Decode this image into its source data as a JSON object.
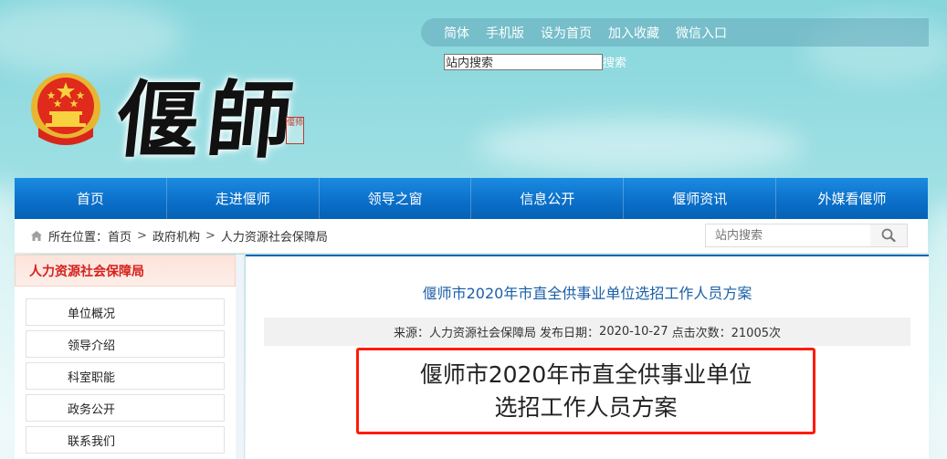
{
  "header": {
    "logo_text": "偃師",
    "seal_text": "偃师",
    "emblem_icon": "national-emblem",
    "top_links": [
      "简体",
      "手机版",
      "设为首页",
      "加入收藏",
      "微信入口"
    ],
    "top_search": {
      "value": "站内搜索",
      "button_label": "搜索"
    }
  },
  "nav": {
    "items": [
      "首页",
      "走进偃师",
      "领导之窗",
      "信息公开",
      "偃师资讯",
      "外媒看偃师"
    ]
  },
  "breadcrumb": {
    "home_icon": "home-icon",
    "label": "所在位置：",
    "items": [
      "首页",
      "政府机构",
      "人力资源社会保障局"
    ],
    "separator": ">"
  },
  "crumb_search": {
    "placeholder": "站内搜索",
    "icon": "search-icon"
  },
  "sidebar": {
    "title": "人力资源社会保障局",
    "items": [
      "单位概况",
      "领导介绍",
      "科室职能",
      "政务公开",
      "联系我们"
    ]
  },
  "article": {
    "title": "偃师市2020年市直全供事业单位选招工作人员方案",
    "meta": {
      "source_label": "来源：",
      "source": "人力资源社会保障局",
      "date_label": "发布日期：",
      "date": "2020-10-27",
      "views_label": "点击次数：",
      "views": "21005次"
    },
    "headline_line1": "偃师市2020年市直全供事业单位",
    "headline_line2": "选招工作人员方案"
  },
  "colors": {
    "nav_blue": "#0a6ec8",
    "title_blue": "#1a5fa8",
    "sidebar_red": "#d6211d",
    "highlight_red": "#ff1a0a"
  }
}
